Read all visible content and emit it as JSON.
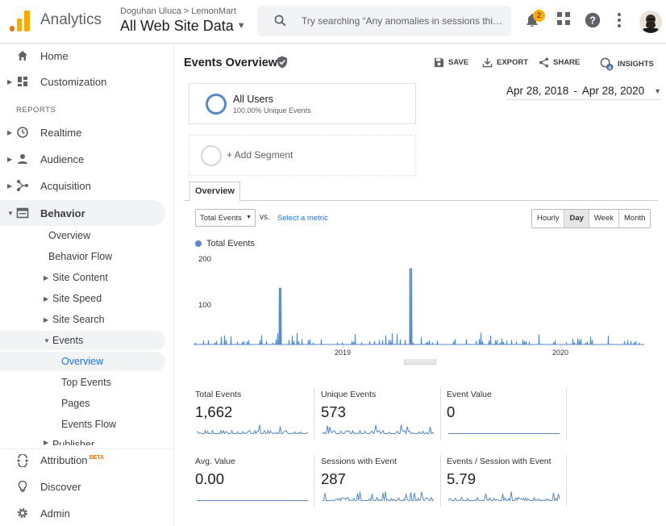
{
  "header": {
    "brand": "Analytics",
    "account": "Doguhan Uluca",
    "property": "LemonMart",
    "crumb_sep": ">",
    "view": "All Web Site Data",
    "search_placeholder": "Try searching “Any anomalies in sessions thi…",
    "notifications_count": "2",
    "logo_colors": [
      "#f9ab00",
      "#e37400"
    ]
  },
  "sidebar": {
    "top_items": [
      {
        "label": "Home",
        "icon": "home-icon"
      },
      {
        "label": "Customization",
        "icon": "dashboard-icon"
      }
    ],
    "reports_label": "REPORTS",
    "report_items": [
      {
        "label": "Realtime",
        "icon": "clock-icon"
      },
      {
        "label": "Audience",
        "icon": "person-icon"
      },
      {
        "label": "Acquisition",
        "icon": "acquisition-icon"
      },
      {
        "label": "Behavior",
        "icon": "behavior-icon"
      }
    ],
    "behavior_sub": [
      {
        "label": "Overview"
      },
      {
        "label": "Behavior Flow"
      },
      {
        "label": "Site Content"
      },
      {
        "label": "Site Speed"
      },
      {
        "label": "Site Search"
      },
      {
        "label": "Events"
      }
    ],
    "events_sub": [
      {
        "label": "Overview"
      },
      {
        "label": "Top Events"
      },
      {
        "label": "Pages"
      },
      {
        "label": "Events Flow"
      },
      {
        "label": "Publisher"
      }
    ],
    "bottom_items": [
      {
        "label": "Attribution",
        "badge": "BETA",
        "icon": "attribution-icon"
      },
      {
        "label": "Discover",
        "icon": "lightbulb-icon"
      },
      {
        "label": "Admin",
        "icon": "gear-icon"
      }
    ]
  },
  "page": {
    "title": "Events Overview",
    "actions": {
      "save": "SAVE",
      "export": "EXPORT",
      "share": "SHARE",
      "insights": "INSIGHTS",
      "insights_badge": "4"
    },
    "segment": {
      "name": "All Users",
      "stat": "100.00% Unique Events"
    },
    "add_segment": "+ Add Segment",
    "date_start": "Apr 28, 2018",
    "date_sep": "-",
    "date_end": "Apr 28, 2020",
    "tab": "Overview",
    "metric": "Total Events",
    "vs": "vs.",
    "select_metric": "Select a metric",
    "granularity": [
      "Hourly",
      "Day",
      "Week",
      "Month"
    ],
    "granularity_selected": "Day",
    "accent": "#5a89c6"
  },
  "chart_data": {
    "type": "line",
    "series": [
      {
        "name": "Total Events"
      }
    ],
    "y_ticks": [
      "200",
      "100"
    ],
    "x_ticks": [
      "2019",
      "2020"
    ],
    "ylim": [
      0,
      200
    ],
    "x_range": [
      "Apr 28, 2018",
      "Apr 28, 2020"
    ],
    "spikes": [
      {
        "date": "2018-09-15",
        "value": 130
      },
      {
        "date": "2019-04-15",
        "value": 175
      }
    ],
    "baseline_typical": 8
  },
  "metrics": [
    {
      "label": "Total Events",
      "value": "1,662"
    },
    {
      "label": "Unique Events",
      "value": "573"
    },
    {
      "label": "Event Value",
      "value": "0"
    },
    {
      "label": "Avg. Value",
      "value": "0.00"
    },
    {
      "label": "Sessions with Event",
      "value": "287"
    },
    {
      "label": "Events / Session with Event",
      "value": "5.79"
    }
  ]
}
